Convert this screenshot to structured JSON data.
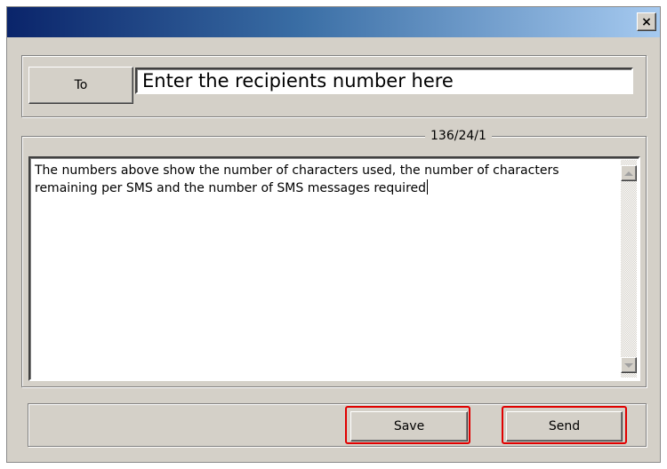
{
  "window": {
    "close_label": "×"
  },
  "recipient": {
    "to_label": "To",
    "value": "Enter the recipients number here"
  },
  "message": {
    "counter": "136/24/1",
    "text": "The numbers above show the number of characters used, the number of characters remaining per SMS and the number of SMS messages required"
  },
  "actions": {
    "save_label": "Save",
    "send_label": "Send"
  },
  "colors": {
    "title_gradient_start": "#0a246a",
    "title_gradient_end": "#a6caf0",
    "dialog_background": "#d4d0c8",
    "highlight": "#e00000"
  }
}
